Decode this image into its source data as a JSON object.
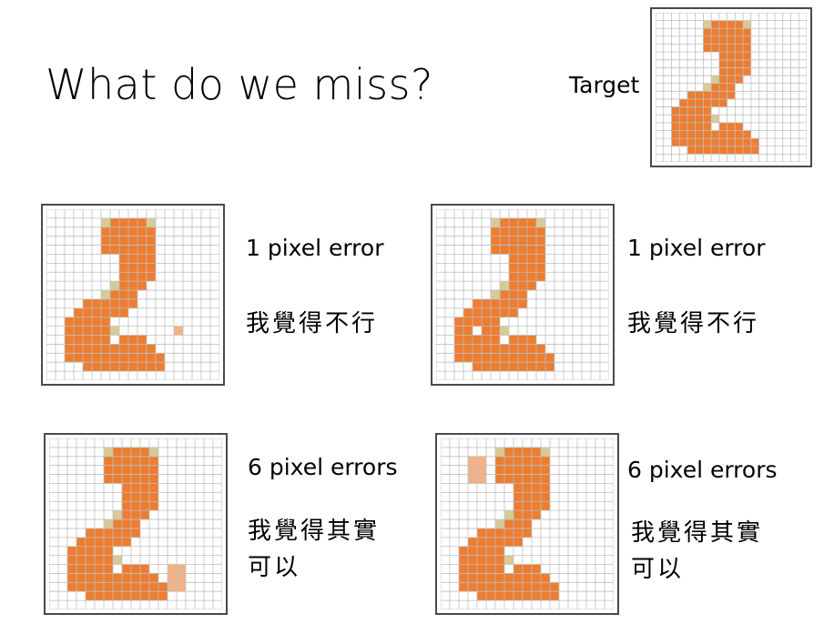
{
  "slide": {
    "title": "What do we miss?",
    "target_label": "Target"
  },
  "colors": {
    "digit": "#ED7D31",
    "edge": "#D6CB97",
    "error_light": "#F4B183",
    "missing": "#FFFFFF",
    "grid_line": "#BFBFBF"
  },
  "grid": {
    "rows": 19,
    "cols": 19,
    "digit_bitmap": [
      "...................",
      "......E####E.......",
      "......######.......",
      "......######.......",
      "......######.......",
      "........####.......",
      "........####.......",
      "........####.......",
      ".......E###........",
      "......E###.........",
      "....######.........",
      "...######..........",
      "..#####............",
      "..#####E...........",
      "..#####.###........",
      "..##########.......",
      "..###########......",
      "....#########......",
      "..................."
    ]
  },
  "examples": [
    {
      "id": "target",
      "caption": "",
      "comment_lines": [],
      "errors": []
    },
    {
      "id": "example-1",
      "caption": "1 pixel error",
      "comment_lines": [
        "我覺得不行"
      ],
      "errors": [
        {
          "row": 13,
          "col": 14,
          "type": "error_light"
        }
      ]
    },
    {
      "id": "example-2",
      "caption": "1 pixel error",
      "comment_lines": [
        "我覺得不行"
      ],
      "errors": [
        {
          "row": 13,
          "col": 4,
          "type": "missing"
        }
      ]
    },
    {
      "id": "example-3",
      "caption": "6 pixel errors",
      "comment_lines": [
        "我覺得其實",
        "可以"
      ],
      "errors": [
        {
          "row": 14,
          "col": 13,
          "type": "error_light"
        },
        {
          "row": 14,
          "col": 14,
          "type": "error_light"
        },
        {
          "row": 15,
          "col": 13,
          "type": "error_light"
        },
        {
          "row": 15,
          "col": 14,
          "type": "error_light"
        },
        {
          "row": 16,
          "col": 13,
          "type": "error_light"
        },
        {
          "row": 16,
          "col": 14,
          "type": "error_light"
        }
      ]
    },
    {
      "id": "example-4",
      "caption": "6 pixel errors",
      "comment_lines": [
        "我覺得其實",
        "可以"
      ],
      "errors": [
        {
          "row": 2,
          "col": 3,
          "type": "error_light"
        },
        {
          "row": 2,
          "col": 4,
          "type": "error_light"
        },
        {
          "row": 3,
          "col": 3,
          "type": "error_light"
        },
        {
          "row": 3,
          "col": 4,
          "type": "error_light"
        },
        {
          "row": 4,
          "col": 3,
          "type": "error_light"
        },
        {
          "row": 4,
          "col": 4,
          "type": "error_light"
        }
      ]
    }
  ]
}
